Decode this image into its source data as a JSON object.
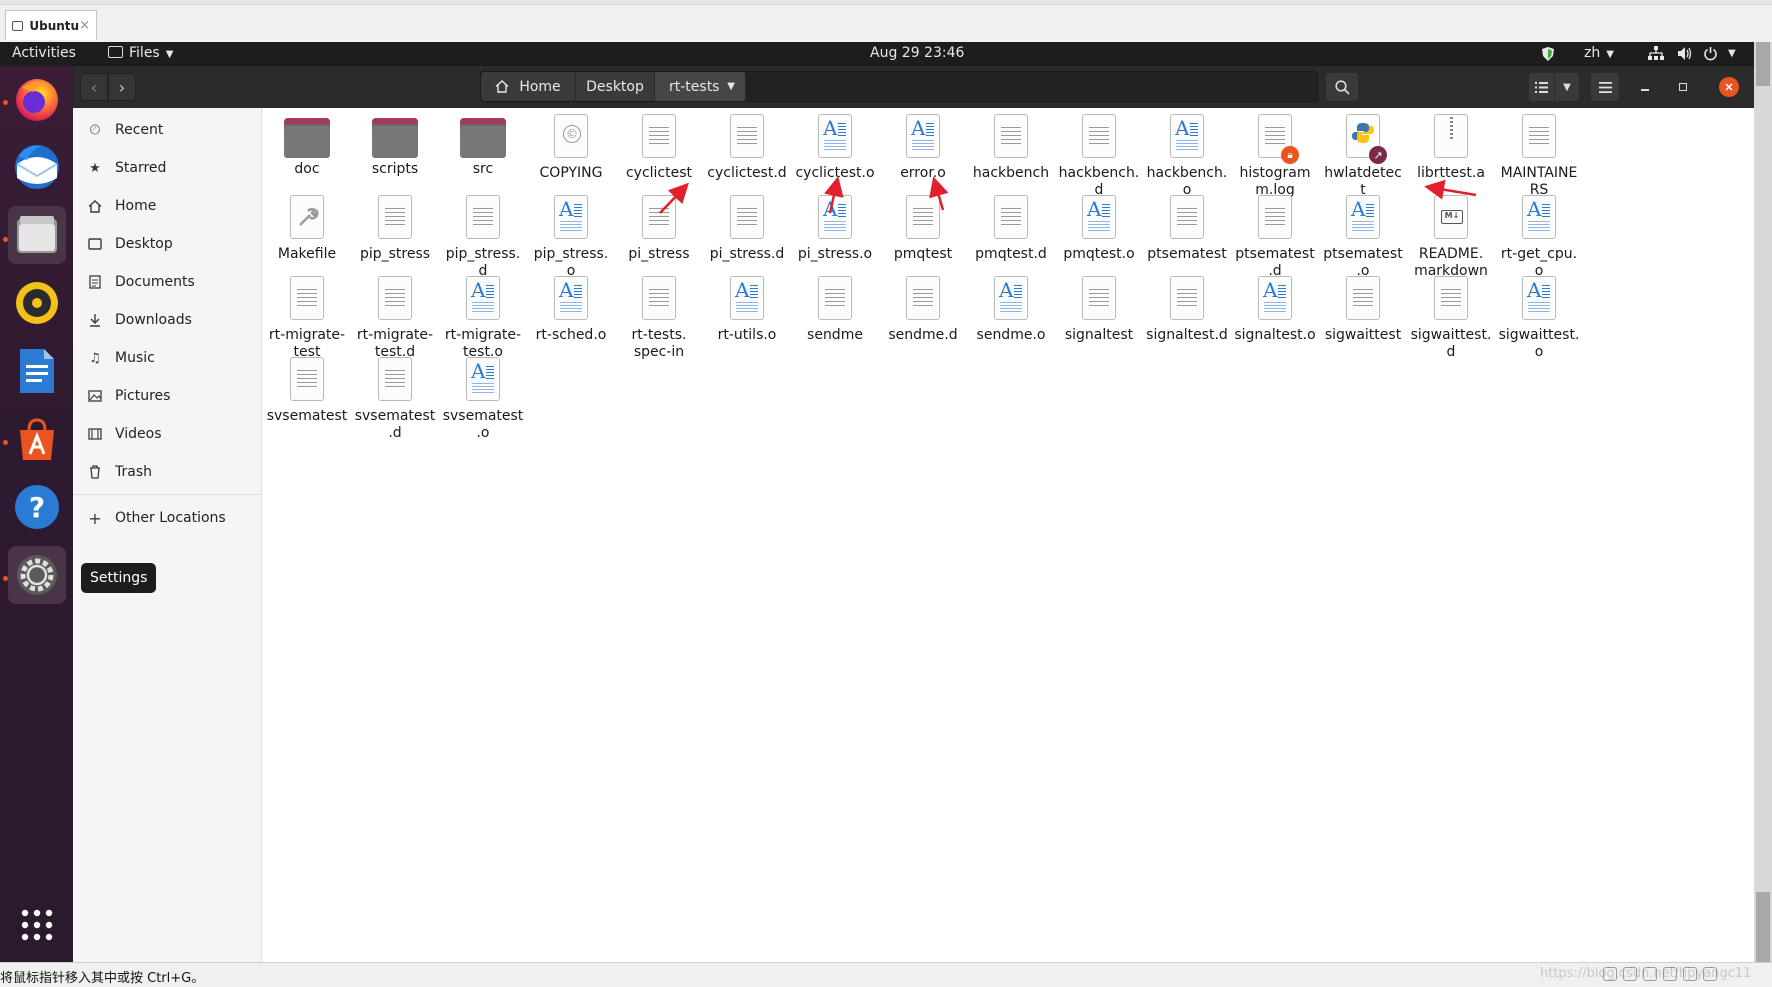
{
  "host_tab": {
    "title": "Ubuntu",
    "close_label": "×"
  },
  "topbar": {
    "activities": "Activities",
    "app_menu": "Files",
    "clock": "Aug 29  23:46",
    "language": "zh"
  },
  "dock": {
    "items": [
      {
        "name": "firefox",
        "running": true
      },
      {
        "name": "thunderbird",
        "running": false
      },
      {
        "name": "files",
        "running": true
      },
      {
        "name": "rhythmbox",
        "running": false
      },
      {
        "name": "libreoffice-writer",
        "running": false
      },
      {
        "name": "ubuntu-software",
        "running": true
      },
      {
        "name": "help",
        "running": false
      },
      {
        "name": "settings",
        "running": true
      }
    ],
    "tooltip": "Settings"
  },
  "header": {
    "back_icon": "chevron-left-icon",
    "forward_icon": "chevron-right-icon",
    "breadcrumb": [
      "Home",
      "Desktop",
      "rt-tests"
    ]
  },
  "sidebar": {
    "items": [
      {
        "label": "Recent",
        "icon": "clock-icon"
      },
      {
        "label": "Starred",
        "icon": "star-icon"
      },
      {
        "label": "Home",
        "icon": "home-icon"
      },
      {
        "label": "Desktop",
        "icon": "desktop-icon"
      },
      {
        "label": "Documents",
        "icon": "document-icon"
      },
      {
        "label": "Downloads",
        "icon": "download-icon"
      },
      {
        "label": "Music",
        "icon": "music-icon"
      },
      {
        "label": "Pictures",
        "icon": "picture-icon"
      },
      {
        "label": "Videos",
        "icon": "video-icon"
      },
      {
        "label": "Trash",
        "icon": "trash-icon"
      }
    ],
    "other_locations": "Other Locations"
  },
  "files": [
    {
      "name": "doc",
      "type": "folder"
    },
    {
      "name": "scripts",
      "type": "folder"
    },
    {
      "name": "src",
      "type": "folder"
    },
    {
      "name": "COPYING",
      "type": "copyright"
    },
    {
      "name": "cyclictest",
      "type": "text"
    },
    {
      "name": "cyclictest.d",
      "type": "text"
    },
    {
      "name": "cyclictest.o",
      "type": "object"
    },
    {
      "name": "error.o",
      "type": "object"
    },
    {
      "name": "hackbench",
      "type": "text"
    },
    {
      "name": "hackbench.\nd",
      "type": "text"
    },
    {
      "name": "hackbench.\no",
      "type": "object"
    },
    {
      "name": "histogram\nm.log",
      "type": "locked"
    },
    {
      "name": "hwlatdetec\nt",
      "type": "python"
    },
    {
      "name": "librttest.a",
      "type": "archive"
    },
    {
      "name": "MAINTAINE\nRS",
      "type": "text"
    },
    {
      "name": "Makefile",
      "type": "makefile"
    },
    {
      "name": "pip_stress",
      "type": "text"
    },
    {
      "name": "pip_stress.\nd",
      "type": "text"
    },
    {
      "name": "pip_stress.\no",
      "type": "object"
    },
    {
      "name": "pi_stress",
      "type": "text"
    },
    {
      "name": "pi_stress.d",
      "type": "text"
    },
    {
      "name": "pi_stress.o",
      "type": "object"
    },
    {
      "name": "pmqtest",
      "type": "text"
    },
    {
      "name": "pmqtest.d",
      "type": "text"
    },
    {
      "name": "pmqtest.o",
      "type": "object"
    },
    {
      "name": "ptsematest",
      "type": "text"
    },
    {
      "name": "ptsematest\n.d",
      "type": "text"
    },
    {
      "name": "ptsematest\n.o",
      "type": "object"
    },
    {
      "name": "README.\nmarkdown",
      "type": "markdown"
    },
    {
      "name": "rt-get_cpu.\no",
      "type": "object"
    },
    {
      "name": "rt-migrate-\ntest",
      "type": "text"
    },
    {
      "name": "rt-migrate-\ntest.d",
      "type": "text"
    },
    {
      "name": "rt-migrate-\ntest.o",
      "type": "object"
    },
    {
      "name": "rt-sched.o",
      "type": "object"
    },
    {
      "name": "rt-tests.\nspec-in",
      "type": "text"
    },
    {
      "name": "rt-utils.o",
      "type": "object"
    },
    {
      "name": "sendme",
      "type": "text"
    },
    {
      "name": "sendme.d",
      "type": "text"
    },
    {
      "name": "sendme.o",
      "type": "object"
    },
    {
      "name": "signaltest",
      "type": "text"
    },
    {
      "name": "signaltest.d",
      "type": "text"
    },
    {
      "name": "signaltest.o",
      "type": "object"
    },
    {
      "name": "sigwaittest",
      "type": "text"
    },
    {
      "name": "sigwaittest.\nd",
      "type": "text"
    },
    {
      "name": "sigwaittest.\no",
      "type": "object"
    },
    {
      "name": "svsematest",
      "type": "text"
    },
    {
      "name": "svsematest\n.d",
      "type": "text"
    },
    {
      "name": "svsematest\n.o",
      "type": "object"
    }
  ],
  "annotations": {
    "arrow_color": "#e0202a"
  },
  "statusbar": {
    "text": "将鼠标指针移入其中或按 Ctrl+G。",
    "watermark": "https://blog.csdn.net/hpyangc11"
  },
  "colors": {
    "accent": "#e95420",
    "dock_bg": "#2e1a30",
    "header_bg": "#2b2b2b"
  }
}
